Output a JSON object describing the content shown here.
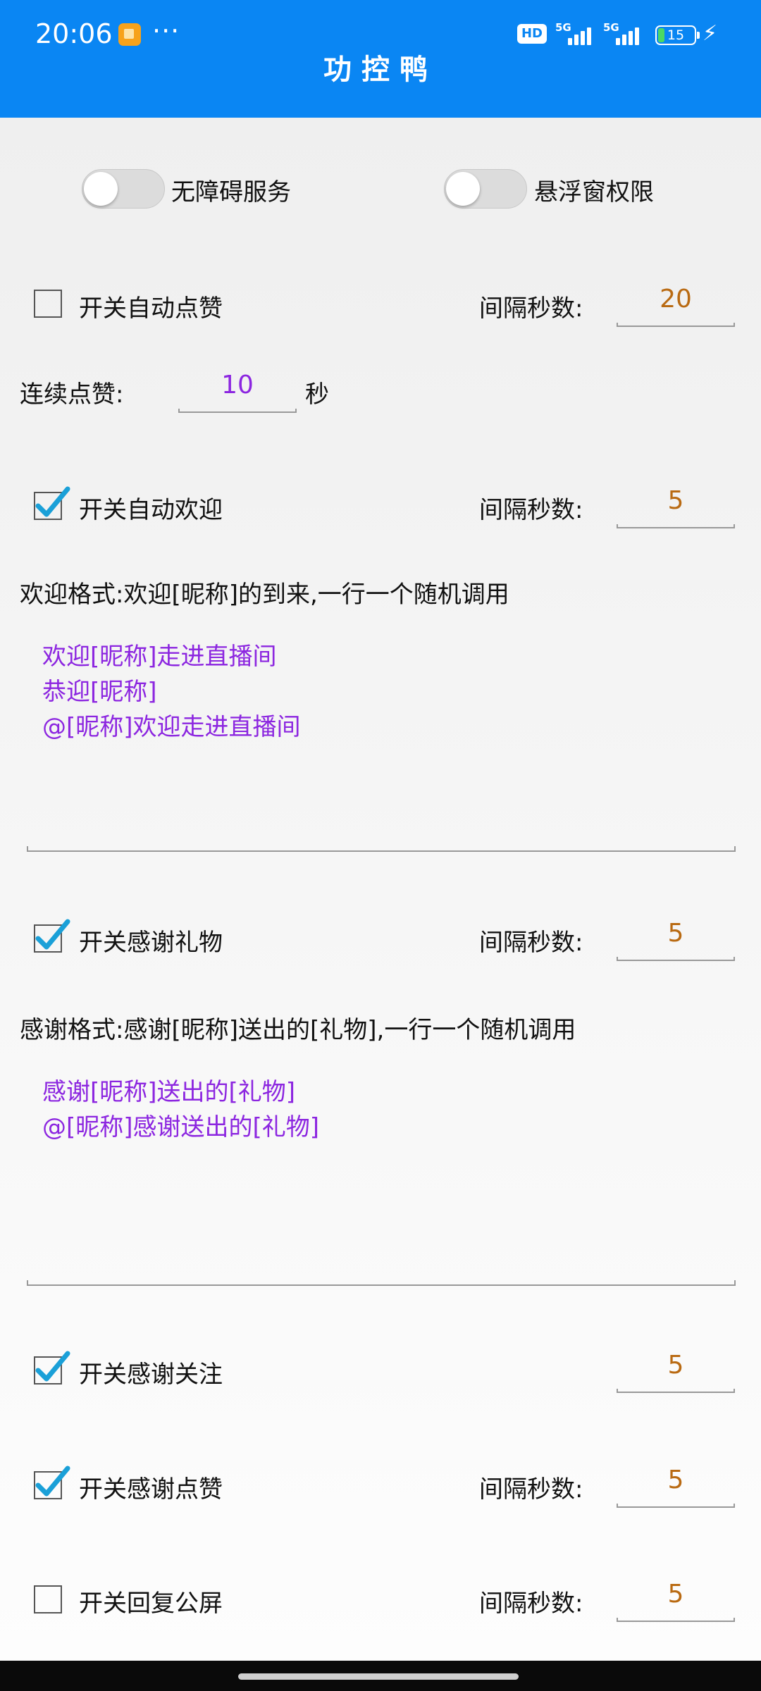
{
  "status": {
    "time": "20:06",
    "more": "···",
    "hd": "HD",
    "net1": "5G",
    "net2": "5G",
    "battery": "15",
    "charge": "⚡"
  },
  "app": {
    "title": "功控鸭"
  },
  "permissions": {
    "accessibility": "无障碍服务",
    "overlay": "悬浮窗权限"
  },
  "interval_label": "间隔秒数:",
  "auto_like": {
    "label": "开关自动点赞",
    "checked": false,
    "interval": "20"
  },
  "continuous_like": {
    "label": "连续点赞:",
    "value": "10",
    "unit": "秒"
  },
  "auto_welcome": {
    "label": "开关自动欢迎",
    "checked": true,
    "interval": "5",
    "format": "欢迎格式:欢迎[昵称]的到来,一行一个随机调用",
    "lines": [
      "欢迎[昵称]走进直播间",
      "恭迎[昵称]",
      "@[昵称]欢迎走进直播间"
    ]
  },
  "thank_gift": {
    "label": "开关感谢礼物",
    "checked": true,
    "interval": "5",
    "format": "感谢格式:感谢[昵称]送出的[礼物],一行一个随机调用",
    "lines": [
      "感谢[昵称]送出的[礼物]",
      "@[昵称]感谢送出的[礼物]"
    ]
  },
  "thank_follow": {
    "label": "开关感谢关注",
    "checked": true,
    "interval": "5"
  },
  "thank_like": {
    "label": "开关感谢点赞",
    "checked": true,
    "interval": "5"
  },
  "reply_screen": {
    "label": "开关回复公屏",
    "checked": false,
    "interval": "5"
  },
  "colors": {
    "header": "#0a86f3",
    "interval_value": "#b96a12",
    "template_text": "#8c26e0",
    "check": "#1aa0d8"
  }
}
